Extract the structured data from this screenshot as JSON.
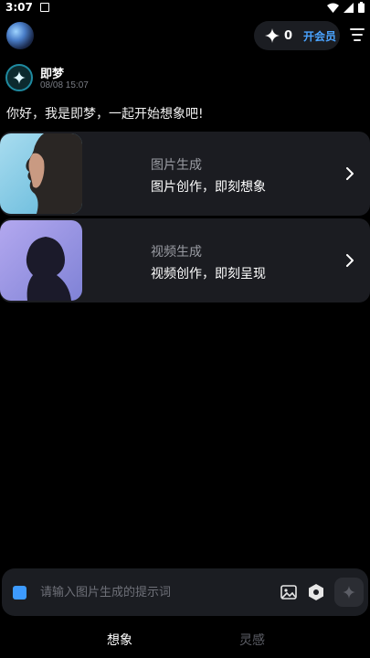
{
  "status_bar": {
    "time": "3:07"
  },
  "header": {
    "credits": "0",
    "vip_label": "开会员"
  },
  "message": {
    "bot_name": "即梦",
    "timestamp": "08/08 15:07",
    "greeting": "你好，我是即梦，一起开始想象吧!"
  },
  "cards": [
    {
      "title": "图片生成",
      "subtitle": "图片创作，即刻想象"
    },
    {
      "title": "视频生成",
      "subtitle": "视频创作，即刻呈现"
    }
  ],
  "input": {
    "placeholder": "请输入图片生成的提示词"
  },
  "tabs": [
    {
      "label": "想象",
      "active": true
    },
    {
      "label": "灵感",
      "active": false
    }
  ],
  "colors": {
    "accent": "#3d9bff",
    "background": "#000000",
    "card": "#1b1c21"
  }
}
